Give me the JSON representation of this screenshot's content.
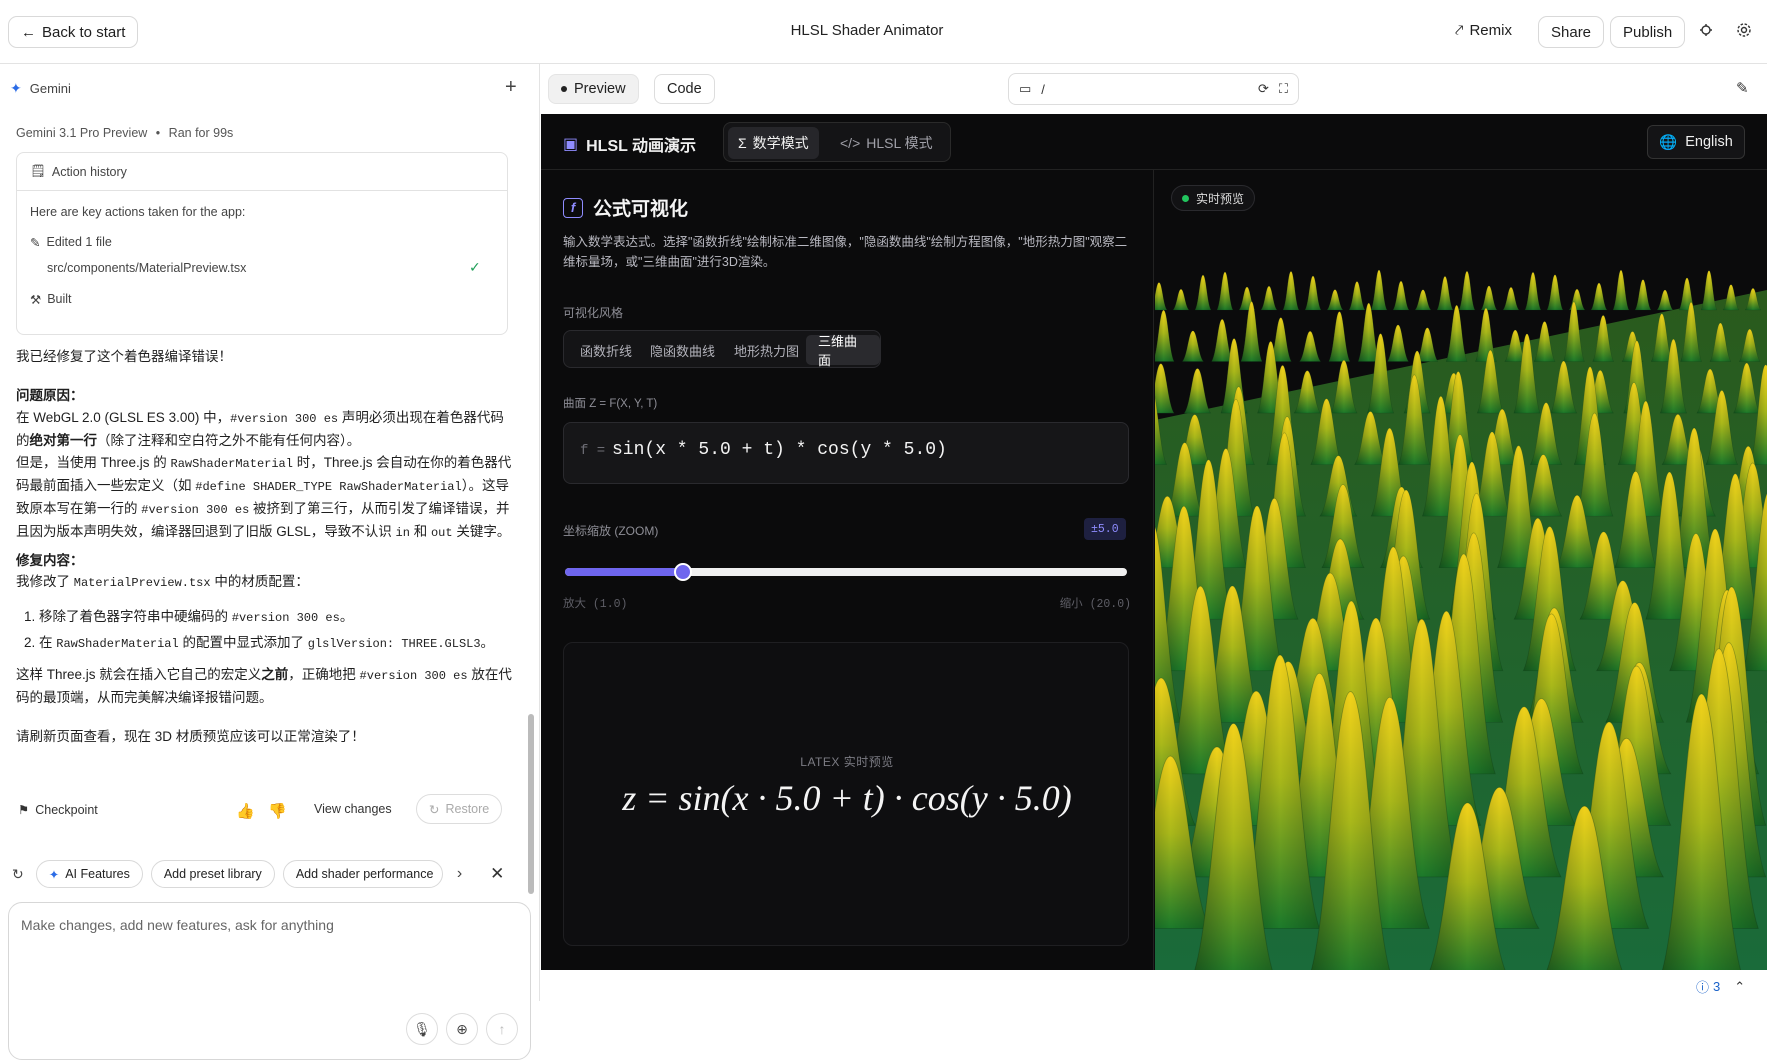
{
  "header": {
    "back_label": "Back to start",
    "title": "HLSL Shader Animator",
    "remix_label": "Remix",
    "share_label": "Share",
    "publish_label": "Publish"
  },
  "chat": {
    "model_brand": "Gemini",
    "run_model": "Gemini 3.1 Pro Preview",
    "run_time": "Ran for 99s",
    "action_history": {
      "title": "Action history",
      "intro": "Here are key actions taken for the app:",
      "edited": "Edited 1 file",
      "file": "src/components/MaterialPreview.tsx",
      "built": "Built"
    },
    "message": {
      "p1": "我已经修复了这个着色器编译错误！",
      "cause_title": "问题原因：",
      "cause_a": "在 WebGL 2.0 (GLSL ES 3.00) 中，",
      "code_version": "#version 300 es",
      "cause_b": " 声明必须出现在着色器代码的",
      "cause_bold": "绝对第一行",
      "cause_c": "（除了注释和空白符之外不能有任何内容）。",
      "cause_d": "但是，当使用 Three.js 的 ",
      "code_raw": "RawShaderMaterial",
      "cause_e": " 时，Three.js 会自动在你的着色器代码最前面插入一些宏定义（如 ",
      "code_define": "#define SHADER_TYPE RawShaderMaterial",
      "cause_f": "）。这导致原本写在第一行的 ",
      "cause_g": " 被挤到了第三行，从而引发了编译错误，并且因为版本声明失效，编译器回退到了旧版 GLSL，导致不认识 ",
      "code_in": "in",
      "cause_h": " 和 ",
      "code_out": "out",
      "cause_i": " 关键字。",
      "fix_title": "修复内容：",
      "fix_a": "我修改了 ",
      "code_file": "MaterialPreview.tsx",
      "fix_b": " 中的材质配置：",
      "li1_a": "移除了着色器字符串中硬编码的 ",
      "li1_b": "。",
      "li2_a": "在 ",
      "li2_b": " 的配置中显式添加了 ",
      "code_glsl": "glslVersion: THREE.GLSL3",
      "li2_c": "。",
      "p3_a": "这样 Three.js 就会在插入它自己的宏定义",
      "p3_bold": "之前",
      "p3_b": "，正确地把 ",
      "p3_c": " 放在代码的最顶端，从而完美解决编译报错问题。",
      "p4": "请刷新页面查看，现在 3D 材质预览应该可以正常渲染了！"
    },
    "checkpoint_label": "Checkpoint",
    "view_changes_label": "View changes",
    "restore_label": "Restore",
    "suggestions": [
      "AI Features",
      "Add preset library",
      "Add shader performance"
    ],
    "input_placeholder": "Make changes, add new features, ask for anything"
  },
  "preview": {
    "tabs": [
      "Preview",
      "Code"
    ],
    "url": "/",
    "app": {
      "title": "HLSL 动画演示",
      "modes": [
        "数学模式",
        "HLSL 模式"
      ],
      "active_mode": "数学模式",
      "language": "English",
      "section_title": "公式可视化",
      "section_desc": "输入数学表达式。选择\"函数折线\"绘制标准二维图像，\"隐函数曲线\"绘制方程图像，\"地形热力图\"观察二维标量场，或\"三维曲面\"进行3D渲染。",
      "style_label": "可视化风格",
      "styles": [
        "函数折线",
        "隐函数曲线",
        "地形热力图",
        "三维曲面"
      ],
      "active_style": "三维曲面",
      "formula_label": "曲面 Z = F(X, Y, T)",
      "formula_prefix": "f =",
      "formula": "sin(x * 5.0 + t) * cos(y * 5.0)",
      "zoom_label": "坐标缩放 (ZOOM)",
      "zoom_badge": "±5.0",
      "zoom_value": 5.0,
      "zoom_min": 1.0,
      "zoom_max": 20.0,
      "zoom_min_label": "放大 (1.0)",
      "zoom_max_label": "缩小 (20.0)",
      "latex_label": "LATEX 实时预览",
      "latex_expr": "z = sin(x · 5.0 + t) · cos(y · 5.0)",
      "live_label": "实时预览"
    }
  },
  "status": {
    "issue_count": "3"
  },
  "colors": {
    "accent": "#6f66ee",
    "live_dot": "#22c55e",
    "app_bg": "#0b0b0c"
  }
}
